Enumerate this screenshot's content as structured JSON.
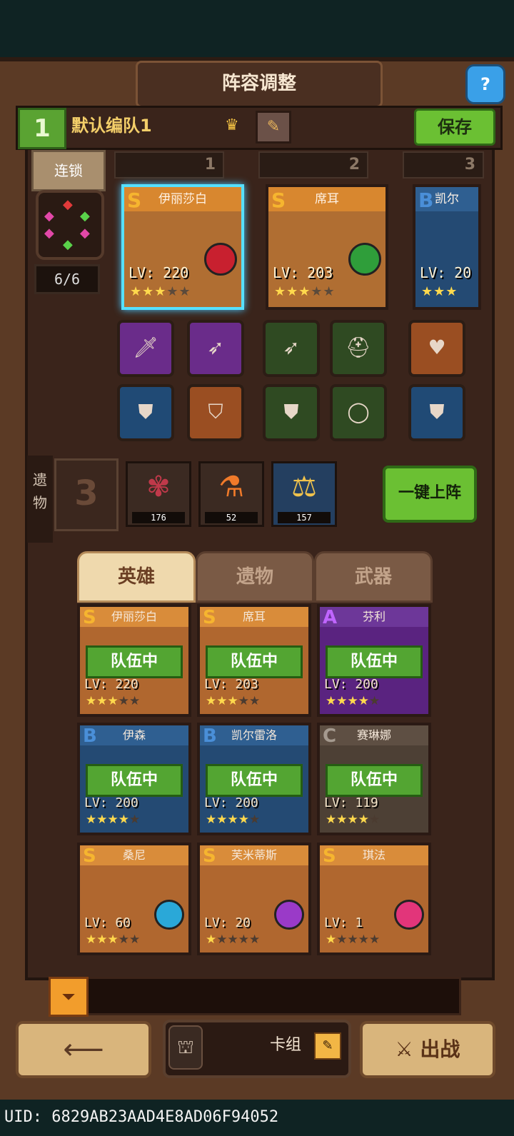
{
  "header": {
    "title": "阵容调整",
    "help_icon": "help-icon"
  },
  "team": {
    "number": "1",
    "name": "默认编队1",
    "crown_icon": "crown-icon",
    "edit_icon": "pencil-icon",
    "save_label": "保存"
  },
  "chain": {
    "label": "连锁",
    "count": "6/6"
  },
  "slots": [
    {
      "number": "1"
    },
    {
      "number": "2"
    },
    {
      "number": "3"
    }
  ],
  "formation": [
    {
      "grade": "S",
      "name": "伊丽莎白",
      "lv": "LV: 220",
      "stars": 3,
      "selected": true
    },
    {
      "grade": "S",
      "name": "席耳",
      "lv": "LV: 203",
      "stars": 3,
      "selected": false
    },
    {
      "grade": "B",
      "name": "凯尔",
      "lv": "LV: 20",
      "stars": 3,
      "selected": false
    }
  ],
  "relics": {
    "label": "遗物",
    "slot_count": "3",
    "items": [
      {
        "icon": "thorn-relic-icon",
        "num": "176"
      },
      {
        "icon": "potion-relic-icon",
        "num": "52"
      },
      {
        "icon": "scales-relic-icon",
        "num": "157"
      }
    ],
    "oneclick_label": "一键上阵"
  },
  "tabs": [
    {
      "label": "英雄",
      "active": true
    },
    {
      "label": "遗物",
      "active": false
    },
    {
      "label": "武器",
      "active": false
    }
  ],
  "roster": [
    {
      "grade": "S",
      "name": "伊丽莎白",
      "lv": "LV: 220",
      "stars": 3,
      "in_team": "队伍中",
      "color": "orange"
    },
    {
      "grade": "S",
      "name": "席耳",
      "lv": "LV: 203",
      "stars": 3,
      "in_team": "队伍中",
      "color": "orange"
    },
    {
      "grade": "A",
      "name": "芬利",
      "lv": "LV: 200",
      "stars": 4,
      "in_team": "队伍中",
      "color": "purple"
    },
    {
      "grade": "B",
      "name": "伊森",
      "lv": "LV: 200",
      "stars": 4,
      "in_team": "队伍中",
      "color": "blue"
    },
    {
      "grade": "B",
      "name": "凯尔雷洛",
      "lv": "LV: 200",
      "stars": 4,
      "in_team": "队伍中",
      "color": "blue"
    },
    {
      "grade": "C",
      "name": "赛琳娜",
      "lv": "LV: 119",
      "stars": 4,
      "in_team": "队伍中",
      "color": "gray"
    },
    {
      "grade": "S",
      "name": "桑尼",
      "lv": "LV: 60",
      "stars": 3,
      "in_team": "",
      "color": "orange"
    },
    {
      "grade": "S",
      "name": "芙米蒂斯",
      "lv": "LV: 20",
      "stars": 1,
      "in_team": "",
      "color": "orange"
    },
    {
      "grade": "S",
      "name": "琪法",
      "lv": "LV: 1",
      "stars": 1,
      "in_team": "",
      "color": "orange"
    }
  ],
  "footer": {
    "back_icon": "back-arrow-icon",
    "deck_label": "卡组",
    "battle_label": "出战",
    "uid": "UID: 6829AB23AAD4E8AD06F94052"
  },
  "colors": {
    "bg": "#0f2323",
    "frame": "#5b3a25",
    "green_button": "#6bc033",
    "selected_glow": "#56e0ff"
  }
}
